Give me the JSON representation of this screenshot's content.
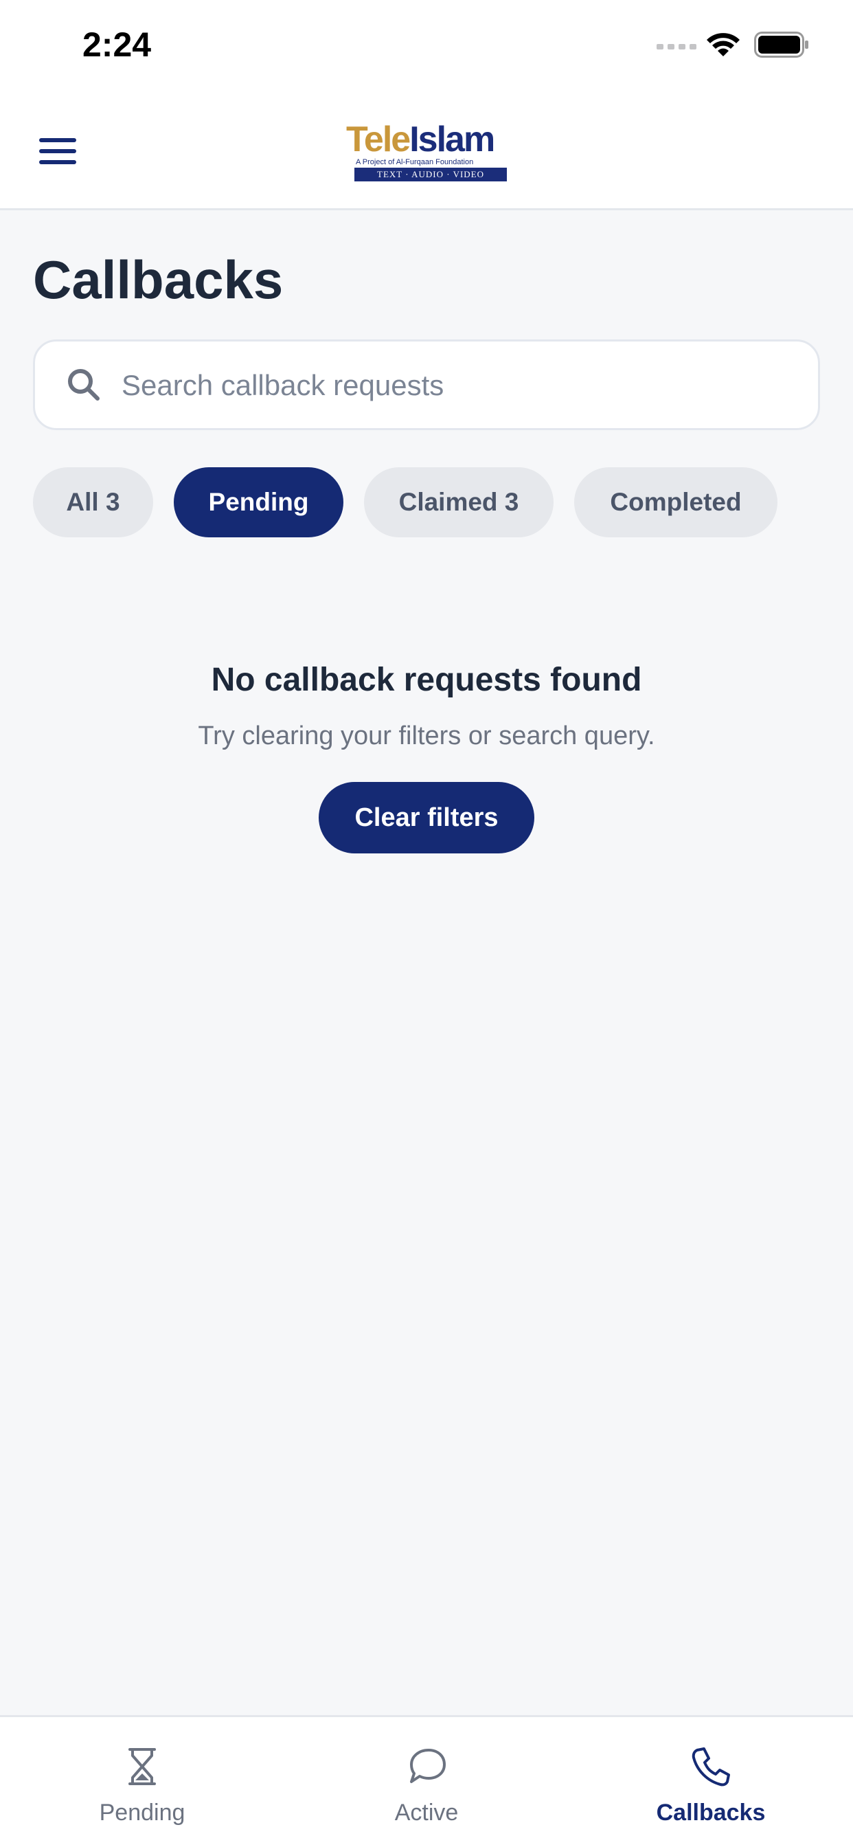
{
  "status_bar": {
    "time": "2:24"
  },
  "header": {
    "logo": {
      "word_part1": "Tele",
      "word_part2": "Islam",
      "tagline": "A Project of Al-Furqaan Foundation",
      "band_text": "TEXT · AUDIO · VIDEO"
    }
  },
  "page": {
    "title": "Callbacks"
  },
  "search": {
    "placeholder": "Search callback requests",
    "value": ""
  },
  "filters": [
    {
      "label": "All 3",
      "selected": false
    },
    {
      "label": "Pending",
      "selected": true
    },
    {
      "label": "Claimed 3",
      "selected": false
    },
    {
      "label": "Completed",
      "selected": false
    }
  ],
  "empty_state": {
    "title": "No callback requests found",
    "subtitle": "Try clearing your filters or search query.",
    "button_label": "Clear filters"
  },
  "tab_bar": {
    "tabs": [
      {
        "label": "Pending",
        "icon": "hourglass-icon",
        "active": false
      },
      {
        "label": "Active",
        "icon": "chat-bubble-icon",
        "active": false
      },
      {
        "label": "Callbacks",
        "icon": "phone-icon",
        "active": true
      }
    ]
  },
  "colors": {
    "primary": "#152a74",
    "logo_gold": "#c9973b",
    "background": "#f6f7f9",
    "chip_inactive": "#e6e8ec"
  }
}
